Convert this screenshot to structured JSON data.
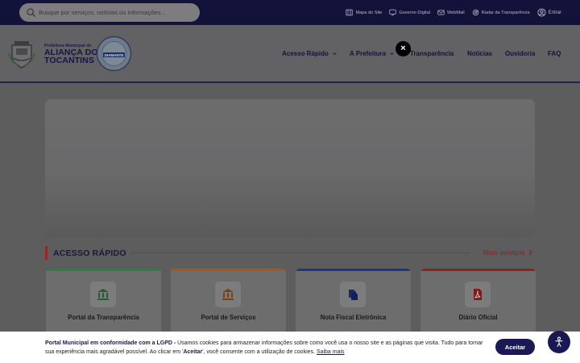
{
  "topbar": {
    "search_placeholder": "Busque por serviços, notícias ou informações...",
    "links": [
      {
        "label": "Mapa do Site",
        "icon": "sitemap-icon"
      },
      {
        "label": "Governo Digital",
        "icon": "monitor-icon"
      },
      {
        "label": "WebMail",
        "icon": "mail-icon"
      },
      {
        "label": "Radar da Transparência",
        "icon": "radar-icon"
      },
      {
        "label": "Entrar",
        "icon": "user-icon"
      }
    ]
  },
  "header": {
    "brand_small": "Prefeitura Municipal de",
    "brand_line1": "ALIANÇA DO",
    "brand_line2": "TOCANTINS",
    "seal_text": "DIAMANTE",
    "nav": [
      {
        "label": "Acesso Rápido"
      },
      {
        "label": "A Prefeitura"
      },
      {
        "label": "Transparência"
      },
      {
        "label": "Notícias"
      },
      {
        "label": "Ouvidoria"
      },
      {
        "label": "FAQ"
      }
    ],
    "close_label": "×"
  },
  "quick_access": {
    "title": "ACESSO RÁPIDO",
    "more_label": "Mais serviços",
    "cards": [
      {
        "label": "Portal da Transparência",
        "stripe": "#2e7d46",
        "icon": "bank-icon"
      },
      {
        "label": "Portal de Serviços",
        "stripe": "#a05a1c",
        "icon": "building-icon"
      },
      {
        "label": "Nota Fiscal Eletrônica",
        "stripe": "#23357c",
        "icon": "documents-icon"
      },
      {
        "label": "Diário Oficial",
        "stripe": "#8e2121",
        "icon": "pdf-icon"
      }
    ]
  },
  "cookie": {
    "bold": "Portal Municipal em conformidade com a LGPD -",
    "text1": " Usamos cookies para armazenar informações sobre como você usa o nosso site e as páginas que visita. Tudo para tornar sua experiência mais agradável possível. Ao clicar em '",
    "aceitar_word": "Aceitar",
    "text2": "', você consente com a utilização de cookies. ",
    "link": "Saiba mais",
    "accept_label": "Aceitar"
  },
  "colors": {
    "topbar": "#13123b",
    "brand": "#1b1852",
    "accent_red": "#8a2121"
  }
}
